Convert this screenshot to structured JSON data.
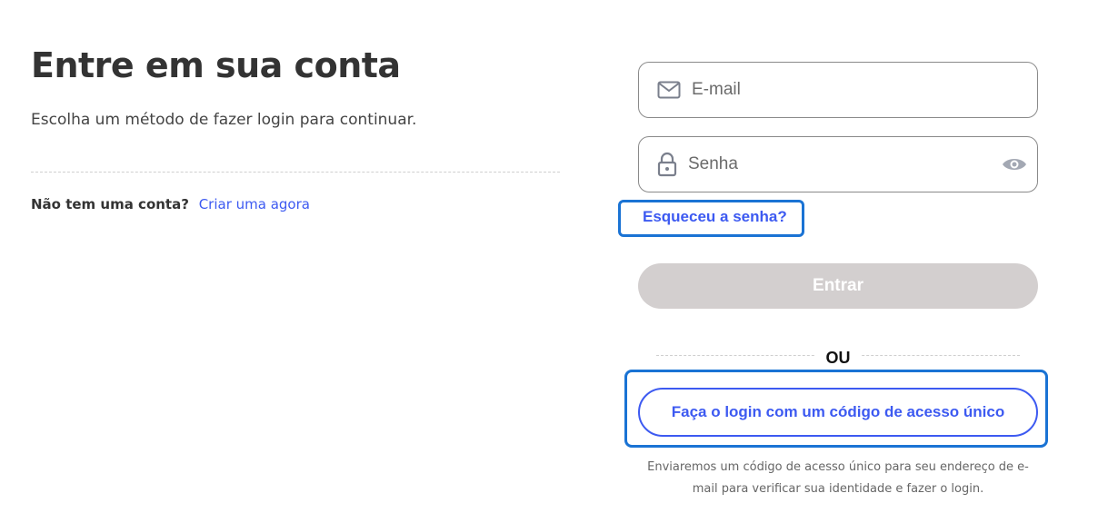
{
  "left": {
    "title": "Entre em sua conta",
    "subtitle": "Escolha um método de fazer login para continuar.",
    "signup_question": "Não tem uma conta?",
    "signup_link": "Criar uma agora"
  },
  "form": {
    "email_placeholder": "E-mail",
    "password_placeholder": "Senha",
    "forgot_link": "Esqueceu a senha?",
    "enter_button": "Entrar",
    "or_label": "OU",
    "code_button": "Faça o login com um código de acesso único",
    "helper_text": "Enviaremos um código de acesso único para seu endereço de e-mail para verificar sua identidade e fazer o login."
  },
  "icons": {
    "email": "mail-icon",
    "password": "lock-icon",
    "toggle_visibility": "eye-icon"
  },
  "colors": {
    "link": "#3d5af1",
    "enter_button_bg": "#d3cfcf",
    "highlight_border": "#1a73d4"
  }
}
